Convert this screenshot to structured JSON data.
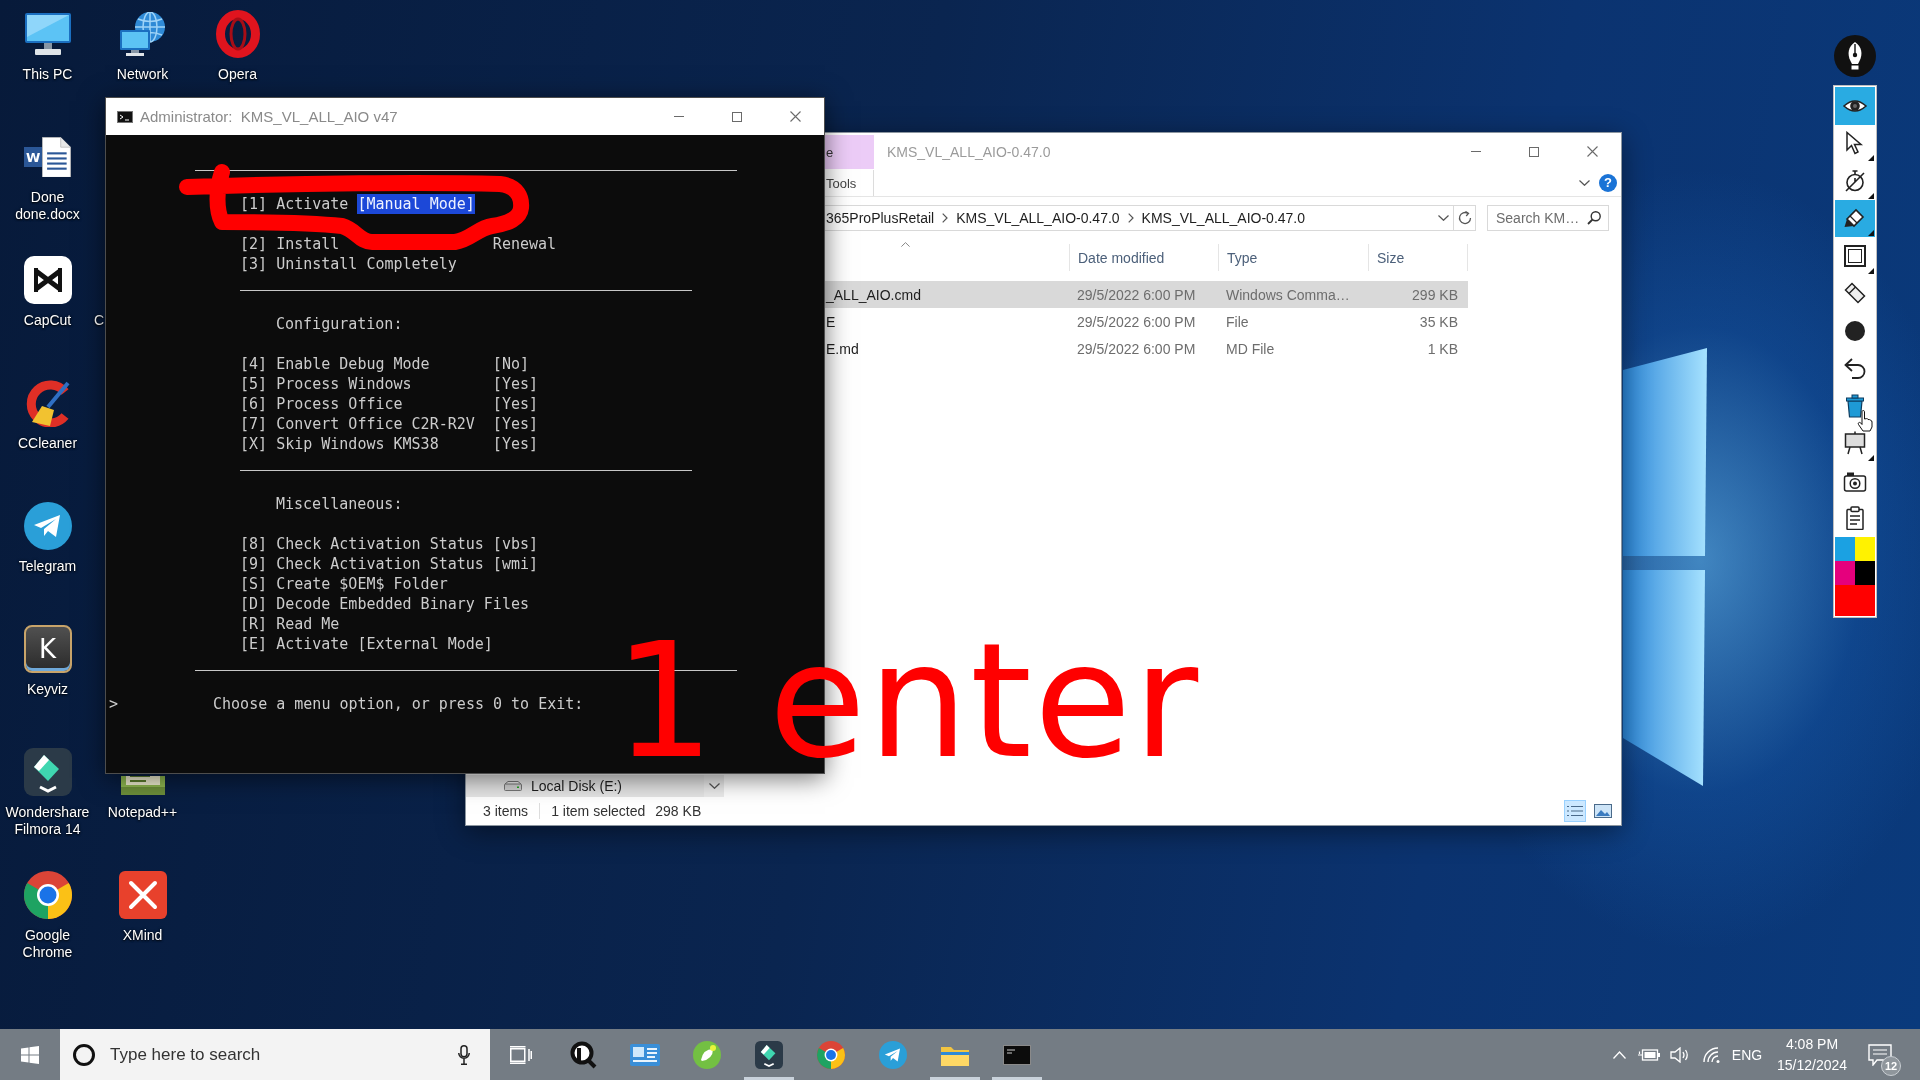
{
  "desktop_icons": [
    {
      "label": "This PC"
    },
    {
      "label": "Network"
    },
    {
      "label": "Opera"
    },
    {
      "label": "Done done.docx",
      "icon_letter": "W"
    },
    {
      "label": "CapCut"
    },
    {
      "label": "C"
    },
    {
      "label": "CCleaner"
    },
    {
      "label": "Telegram"
    },
    {
      "label": "Keyviz",
      "icon_letter": "K"
    },
    {
      "label": "Wondershare Filmora 14"
    },
    {
      "label": "Notepad++"
    },
    {
      "label": "Google Chrome"
    },
    {
      "label": "XMind"
    }
  ],
  "console_window": {
    "title": "Administrator:  KMS_VL_ALL_AIO v47",
    "lines": [
      {
        "kind": "rule",
        "wide": true
      },
      {
        "kind": "blank"
      },
      {
        "kind": "option",
        "key": "[1]",
        "text": "Activate",
        "selected_text": "[Manual Mode]"
      },
      {
        "kind": "blank"
      },
      {
        "kind": "option",
        "key": "[2]",
        "text": "Install",
        "value": "Renewal"
      },
      {
        "kind": "option",
        "key": "[3]",
        "text": "Uninstall Completely"
      },
      {
        "kind": "rule",
        "wide": false
      },
      {
        "kind": "blank"
      },
      {
        "kind": "heading",
        "text": "Configuration:"
      },
      {
        "kind": "blank"
      },
      {
        "kind": "option",
        "key": "[4]",
        "text": "Enable Debug Mode",
        "value": "[No]"
      },
      {
        "kind": "option",
        "key": "[5]",
        "text": "Process Windows",
        "value": "[Yes]"
      },
      {
        "kind": "option",
        "key": "[6]",
        "text": "Process Office",
        "value": "[Yes]"
      },
      {
        "kind": "option",
        "key": "[7]",
        "text": "Convert Office C2R-R2V",
        "value": "[Yes]"
      },
      {
        "kind": "option",
        "key": "[X]",
        "text": "Skip Windows KMS38",
        "value": "[Yes]"
      },
      {
        "kind": "rule",
        "wide": false
      },
      {
        "kind": "blank"
      },
      {
        "kind": "heading",
        "text": "Miscellaneous:"
      },
      {
        "kind": "blank"
      },
      {
        "kind": "option",
        "key": "[8]",
        "text": "Check Activation Status",
        "value": "[vbs]"
      },
      {
        "kind": "option",
        "key": "[9]",
        "text": "Check Activation Status",
        "value": "[wmi]"
      },
      {
        "kind": "option",
        "key": "[S]",
        "text": "Create $OEM$ Folder"
      },
      {
        "kind": "option",
        "key": "[D]",
        "text": "Decode Embedded Binary Files"
      },
      {
        "kind": "option",
        "key": "[R]",
        "text": "Read Me"
      },
      {
        "kind": "option",
        "key": "[E]",
        "text": "Activate [External Mode]"
      },
      {
        "kind": "rule",
        "wide": true
      },
      {
        "kind": "blank"
      },
      {
        "kind": "prompt",
        "marker": ">",
        "text": "Choose a menu option, or press 0 to Exit:"
      }
    ]
  },
  "explorer_window": {
    "context_header": "e",
    "title": "KMS_VL_ALL_AIO-0.47.0",
    "ribbon_tabs": [
      {
        "label": "Tools",
        "selected": false
      }
    ],
    "help": "?",
    "breadcrumb": [
      "365ProPlusRetail",
      "KMS_VL_ALL_AIO-0.47.0",
      "KMS_VL_ALL_AIO-0.47.0"
    ],
    "search": {
      "placeholder": "Search KM…"
    },
    "columns": [
      {
        "sorted": true
      },
      {
        "label": "Date modified",
        "sorted": false
      },
      {
        "label": "Type",
        "sorted": false
      },
      {
        "label": "Size",
        "sorted": false
      }
    ],
    "files": [
      {
        "name": "_ALL_AIO.cmd",
        "date_modified": "29/5/2022 6:00 PM",
        "type": "Windows Comma…",
        "size": "299 KB",
        "selected": true
      },
      {
        "name": "E",
        "date_modified": "29/5/2022 6:00 PM",
        "type": "File",
        "size": "35 KB",
        "selected": false
      },
      {
        "name": "E.md",
        "date_modified": "29/5/2022 6:00 PM",
        "type": "MD File",
        "size": "1 KB",
        "selected": false
      }
    ],
    "nav_item": {
      "label": "Local Disk (E:)"
    },
    "status_bar": {
      "item_count": "3 items",
      "selection": "1 item selected",
      "selection_size": "298 KB"
    },
    "view_buttons": [
      {
        "selected": true
      },
      {
        "selected": false
      }
    ]
  },
  "annotation": {
    "text": "1 enter"
  },
  "pen_toolbar": {
    "tools": [
      {
        "selected": true
      },
      {
        "selected": false
      },
      {
        "selected": false
      },
      {
        "selected": true
      },
      {
        "selected": false
      },
      {
        "selected": false
      },
      {
        "selected": false
      },
      {
        "selected": false
      },
      {
        "selected": false
      },
      {
        "selected": false
      },
      {
        "selected": false
      },
      {
        "selected": false
      }
    ],
    "swatches": [
      {
        "color": "#1ba1e2"
      },
      {
        "color": "#fff200"
      },
      {
        "color": "#e5007d"
      },
      {
        "color": "#000000"
      }
    ],
    "current_color": {
      "color": "#ff0000"
    }
  },
  "taskbar": {
    "search": {
      "placeholder": "Type here to search"
    },
    "apps": [
      {
        "running": false
      },
      {
        "running": false
      },
      {
        "running": false
      },
      {
        "running": true
      },
      {
        "running": false
      },
      {
        "running": false
      },
      {
        "running": true
      },
      {
        "running": true
      }
    ],
    "language": "ENG",
    "clock": {
      "time": "4:08 PM",
      "date": "15/12/2024"
    },
    "notifications": {
      "count": "12"
    }
  }
}
